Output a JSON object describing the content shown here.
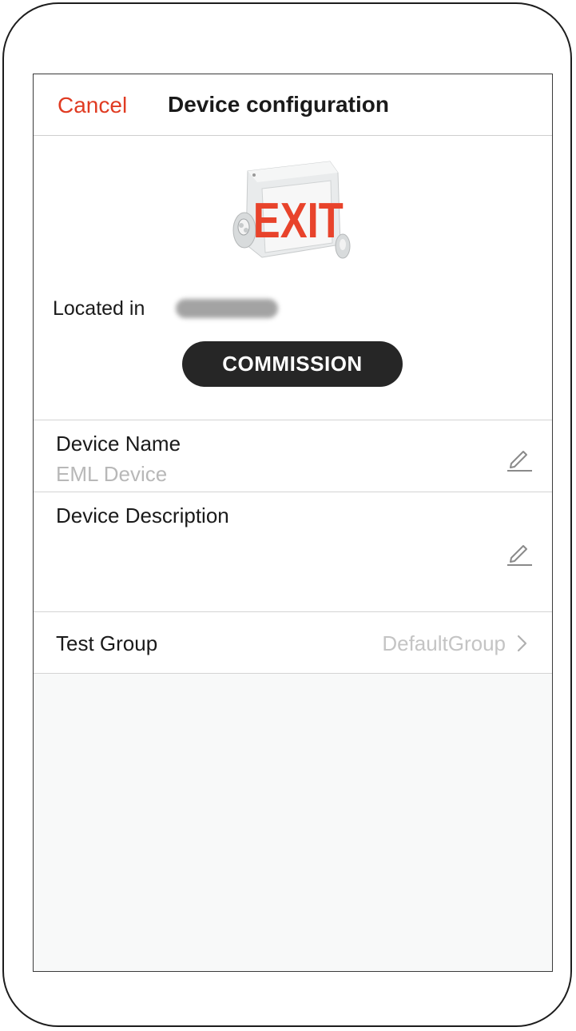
{
  "nav": {
    "cancel_label": "Cancel",
    "title": "Device configuration"
  },
  "device": {
    "image_sign_text": "EXIT",
    "sign_color": "#e8432b",
    "located_label": "Located in",
    "commission_label": "COMMISSION"
  },
  "fields": {
    "name_label": "Device Name",
    "name_value": "EML Device",
    "description_label": "Device Description",
    "description_value": ""
  },
  "test_group": {
    "label": "Test Group",
    "value": "DefaultGroup"
  },
  "colors": {
    "accent": "#e03b22",
    "button_bg": "#262626",
    "muted_text": "#b8b8b8"
  },
  "icons": {
    "edit": "pencil-edit-icon",
    "chevron": "chevron-right-icon"
  }
}
